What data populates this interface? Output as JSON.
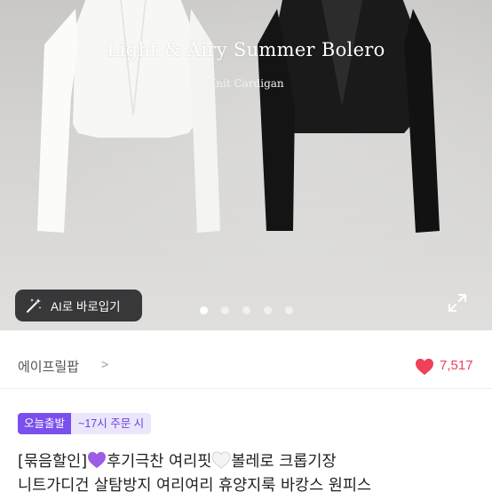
{
  "hero": {
    "title": "Light & Airy Summer Bolero",
    "subtitle": "Knit Cardigan",
    "ai_button_label": "AI로 바로입기",
    "slide_count": 5,
    "active_slide": 1
  },
  "seller": {
    "name": "에이프릴팝",
    "chevron": ">",
    "likes": "7,517"
  },
  "badges": {
    "shipping": "오늘출발",
    "cutoff": "~17시 주문 시"
  },
  "product": {
    "title_line1_a": "[묶음할인]",
    "title_line1_b": "후기극찬 여리핏",
    "title_line1_c": "볼레로 크롭기장",
    "title_line2": "니트가디건  살탐방지 여리여리 휴양지룩 바캉스 원피스"
  },
  "colors": {
    "accent": "#7a4fee",
    "accent_light": "#ece6fd",
    "heart": "#f0405a"
  },
  "icons": [
    "magic-wand-icon",
    "expand-icon",
    "heart-icon",
    "purple-heart-icon",
    "white-heart-icon",
    "chevron-right-icon"
  ]
}
